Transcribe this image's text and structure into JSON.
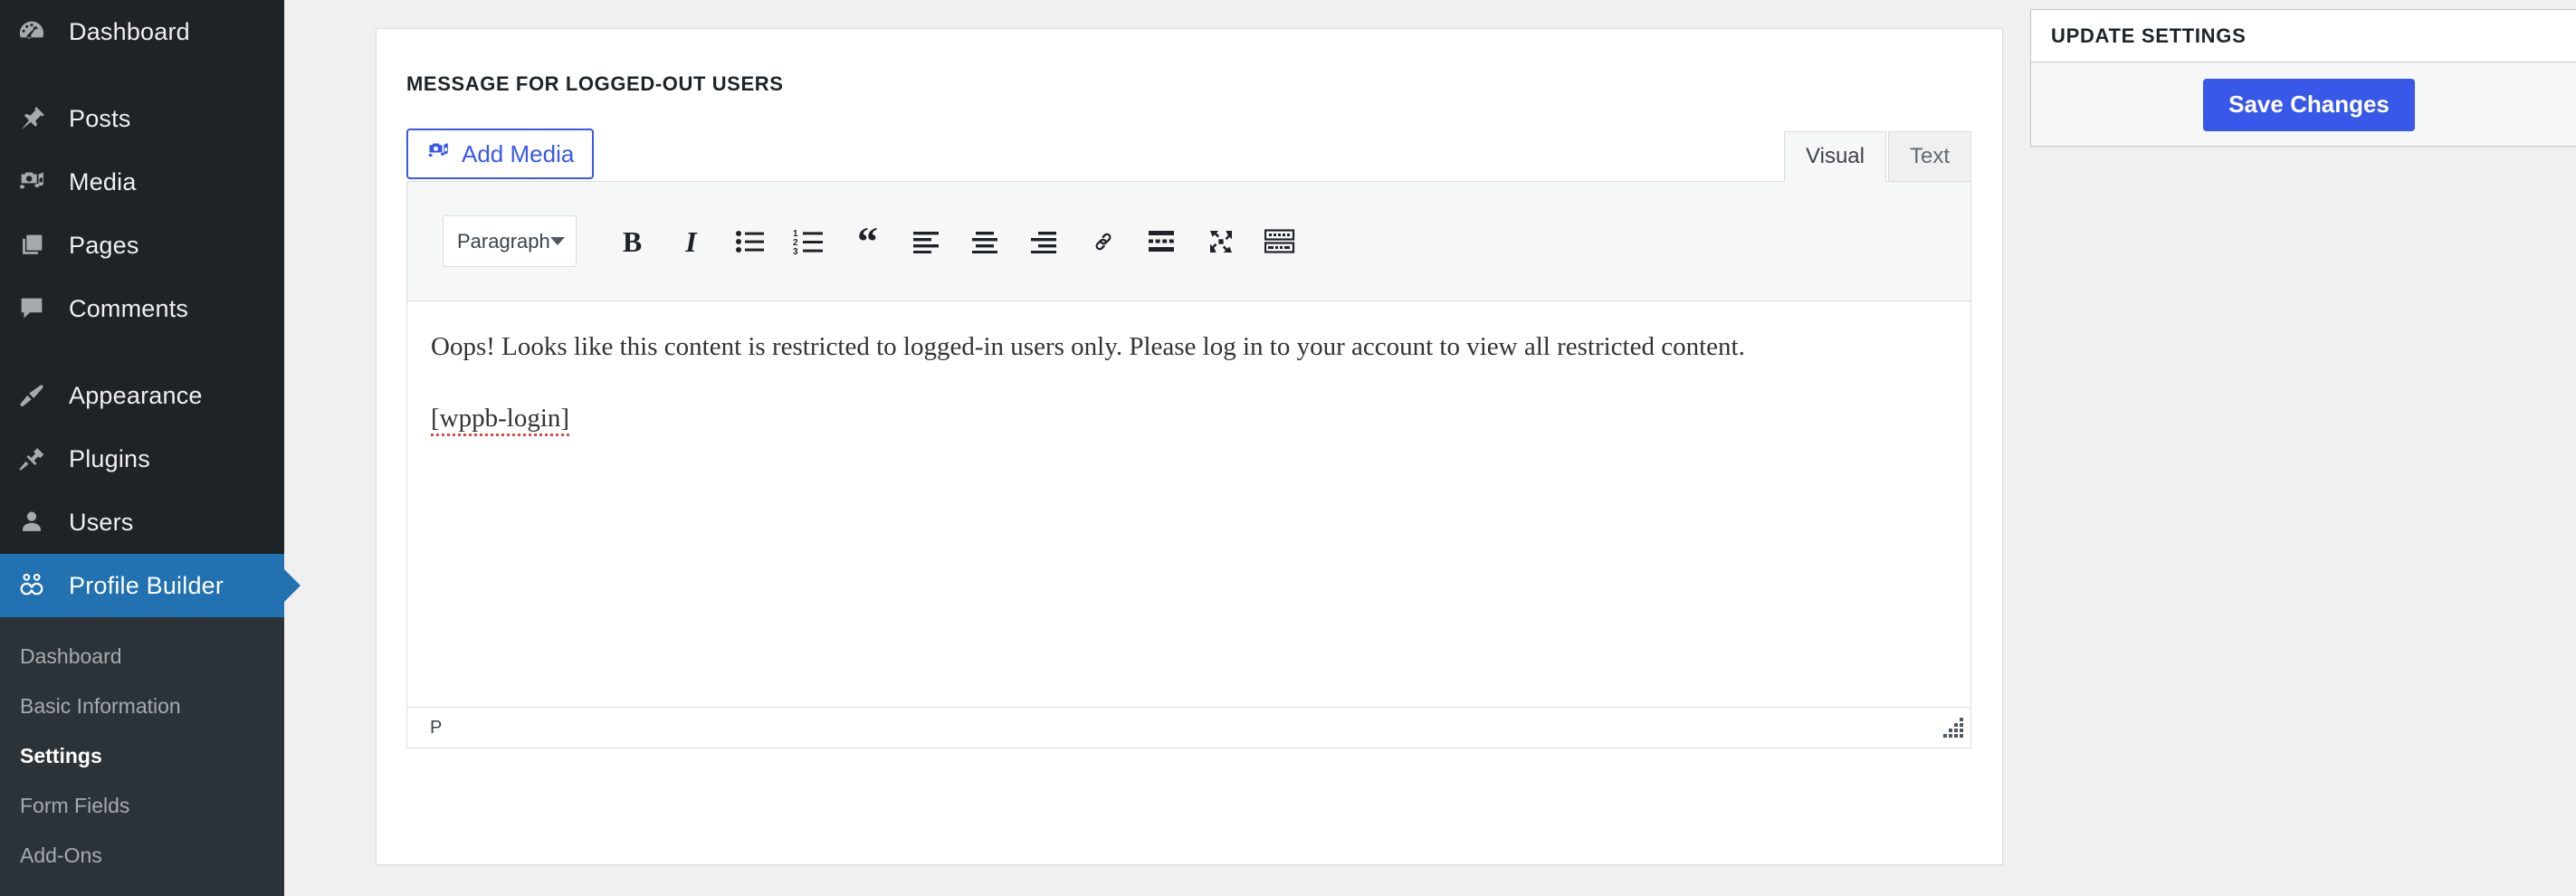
{
  "sidebar": {
    "menu": [
      {
        "label": "Dashboard",
        "icon": "dashboard-icon",
        "current": false
      },
      {
        "label": "Posts",
        "icon": "pin-icon",
        "current": false,
        "gap": true
      },
      {
        "label": "Media",
        "icon": "camera-music-icon",
        "current": false
      },
      {
        "label": "Pages",
        "icon": "pages-icon",
        "current": false
      },
      {
        "label": "Comments",
        "icon": "comment-bubble-icon",
        "current": false
      },
      {
        "label": "Appearance",
        "icon": "paintbrush-icon",
        "current": false,
        "gap": true
      },
      {
        "label": "Plugins",
        "icon": "plug-icon",
        "current": false
      },
      {
        "label": "Users",
        "icon": "user-icon",
        "current": false
      },
      {
        "label": "Profile Builder",
        "icon": "profile-builder-icon",
        "current": true
      }
    ],
    "submenu": [
      {
        "label": "Dashboard",
        "current": false
      },
      {
        "label": "Basic Information",
        "current": false
      },
      {
        "label": "Settings",
        "current": true
      },
      {
        "label": "Form Fields",
        "current": false
      },
      {
        "label": "Add-Ons",
        "current": false
      }
    ],
    "colors": {
      "background": "#1d2327",
      "submenu_background": "#2c3338",
      "current": "#2271b1",
      "text": "#f0f0f1",
      "muted_text": "#a7aaad"
    }
  },
  "main": {
    "box_title": "MESSAGE FOR LOGGED-OUT USERS",
    "add_media_label": "Add Media",
    "tabs": [
      {
        "label": "Visual",
        "active": true
      },
      {
        "label": "Text",
        "active": false
      }
    ],
    "toolbar": {
      "format_select": "Paragraph",
      "buttons": [
        {
          "name": "bold-icon",
          "glyph": "B"
        },
        {
          "name": "italic-icon",
          "glyph": "I"
        },
        {
          "name": "bulleted-list-icon",
          "glyph": ""
        },
        {
          "name": "numbered-list-icon",
          "glyph": ""
        },
        {
          "name": "blockquote-icon",
          "glyph": "“"
        },
        {
          "name": "align-left-icon",
          "glyph": ""
        },
        {
          "name": "align-center-icon",
          "glyph": ""
        },
        {
          "name": "align-right-icon",
          "glyph": ""
        },
        {
          "name": "insert-link-icon",
          "glyph": ""
        },
        {
          "name": "read-more-icon",
          "glyph": ""
        },
        {
          "name": "fullscreen-icon",
          "glyph": ""
        },
        {
          "name": "toolbar-toggle-icon",
          "glyph": ""
        }
      ]
    },
    "content": {
      "paragraph_1": "Oops! Looks like this content is restricted to logged-in users only. Please log in to your account to view all restricted content.",
      "paragraph_2": "[wppb-login]"
    },
    "statusbar_path": "P"
  },
  "side_panel": {
    "title": "UPDATE SETTINGS",
    "save_label": "Save Changes",
    "accent_color": "#3858e9"
  }
}
